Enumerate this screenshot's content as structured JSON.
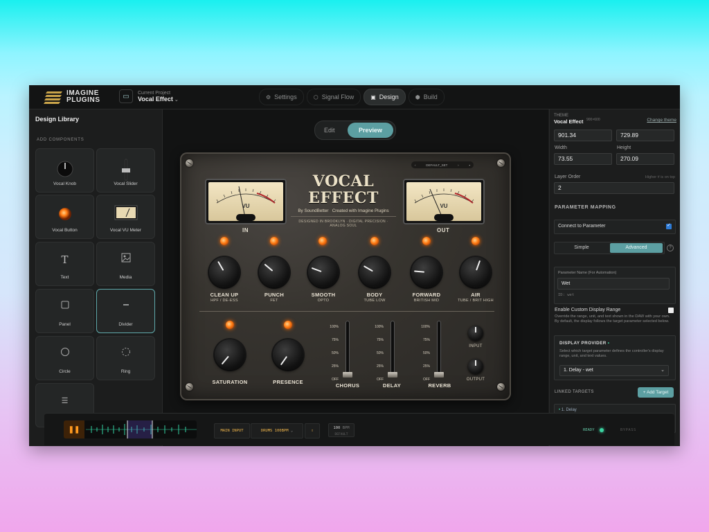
{
  "topbar": {
    "logo_line1": "IMAGINE",
    "logo_line2": "PLUGINS",
    "project_label": "Current Project",
    "project_name": "Vocal Effect",
    "tabs": [
      {
        "label": "Settings",
        "icon": "settings-icon"
      },
      {
        "label": "Signal Flow",
        "icon": "signal-flow-icon"
      },
      {
        "label": "Design",
        "icon": "design-icon",
        "active": true
      },
      {
        "label": "Build",
        "icon": "build-icon"
      }
    ]
  },
  "library": {
    "title": "Design Library",
    "section": "ADD COMPONENTS",
    "components": [
      {
        "label": "Vocal Knob",
        "icon": "knob-icon"
      },
      {
        "label": "Vocal Slider",
        "icon": "slider-icon"
      },
      {
        "label": "Vocal Button",
        "icon": "button-led-icon"
      },
      {
        "label": "Vocal VU Meter",
        "icon": "vu-meter-icon"
      },
      {
        "label": "Text",
        "icon": "text-icon"
      },
      {
        "label": "Media",
        "icon": "image-icon"
      },
      {
        "label": "Panel",
        "icon": "panel-icon"
      },
      {
        "label": "Divider",
        "icon": "divider-icon",
        "selected": true
      },
      {
        "label": "Circle",
        "icon": "circle-icon"
      },
      {
        "label": "Ring",
        "icon": "ring-icon"
      },
      {
        "label": "",
        "icon": "list-icon"
      }
    ]
  },
  "canvas": {
    "mode_edit": "Edit",
    "mode_preview": "Preview",
    "plugin": {
      "title": "VOCAL EFFECT",
      "by": "By SoundBetter",
      "created": "Created with Imagine Plugins",
      "designed": "DESIGNED IN BROOKLYN · DIGITAL PRECISION · ANALOG SOUL",
      "preset": "DEFAULT_SET",
      "meter_face": "VU",
      "meter_in": "IN",
      "meter_out": "OUT",
      "knobs": [
        {
          "label": "CLEAN UP",
          "sub": "HPF / DE-ESS"
        },
        {
          "label": "PUNCH",
          "sub": "FET"
        },
        {
          "label": "SMOOTH",
          "sub": "OPTO"
        },
        {
          "label": "BODY",
          "sub": "TUBE LOW"
        },
        {
          "label": "FORWARD",
          "sub": "BRITISH MID"
        },
        {
          "label": "AIR",
          "sub": "TUBE / BRIT HIGH"
        }
      ],
      "lower_knobs": [
        {
          "label": "SATURATION"
        },
        {
          "label": "PRESENCE"
        }
      ],
      "faders": [
        {
          "label": "CHORUS"
        },
        {
          "label": "DELAY"
        },
        {
          "label": "REVERB"
        }
      ],
      "fader_scale": [
        "100%",
        "75%",
        "50%",
        "25%",
        "OFF"
      ],
      "io": [
        {
          "label": "INPUT"
        },
        {
          "label": "OUTPUT"
        }
      ]
    }
  },
  "inspector": {
    "theme_label": "THEME",
    "theme_name": "Vocal Effect",
    "theme_dims": "900×600",
    "change_theme": "Change theme",
    "x_value": "901.34",
    "y_value": "729.89",
    "width_label": "Width",
    "width_value": "73.55",
    "height_label": "Height",
    "height_value": "270.09",
    "layer_label": "Layer Order",
    "layer_hint": "Higher # is on top",
    "layer_value": "2",
    "mapping_title": "PARAMETER MAPPING",
    "connect_label": "Connect to Parameter",
    "mode_simple": "Simple",
    "mode_advanced": "Advanced",
    "param_name_label": "Parameter Name (For Automation)",
    "param_name_value": "Wet",
    "param_id": "ID: wet",
    "custom_range_label": "Enable Custom Display Range",
    "custom_range_desc": "Override the range, unit, and text shown in the DAW with your own. By default, the display follows the target parameter selected below.",
    "provider_title": "DISPLAY PROVIDER",
    "provider_desc": "Select which target parameter defines the controller's display range, unit, and text values.",
    "provider_value": "1. Delay - wet",
    "linked_title": "LINKED TARGETS",
    "add_target": "+ Add Target",
    "linked_item": "1. Delay"
  },
  "transport": {
    "main_input": "MAIN INPUT",
    "source": "DRUMS 100BPM",
    "bpm_value": "100",
    "bpm_unit": "BPM",
    "bpm_sub": "DEFAULT",
    "ready": "READY",
    "bypass": "BYPASS"
  }
}
